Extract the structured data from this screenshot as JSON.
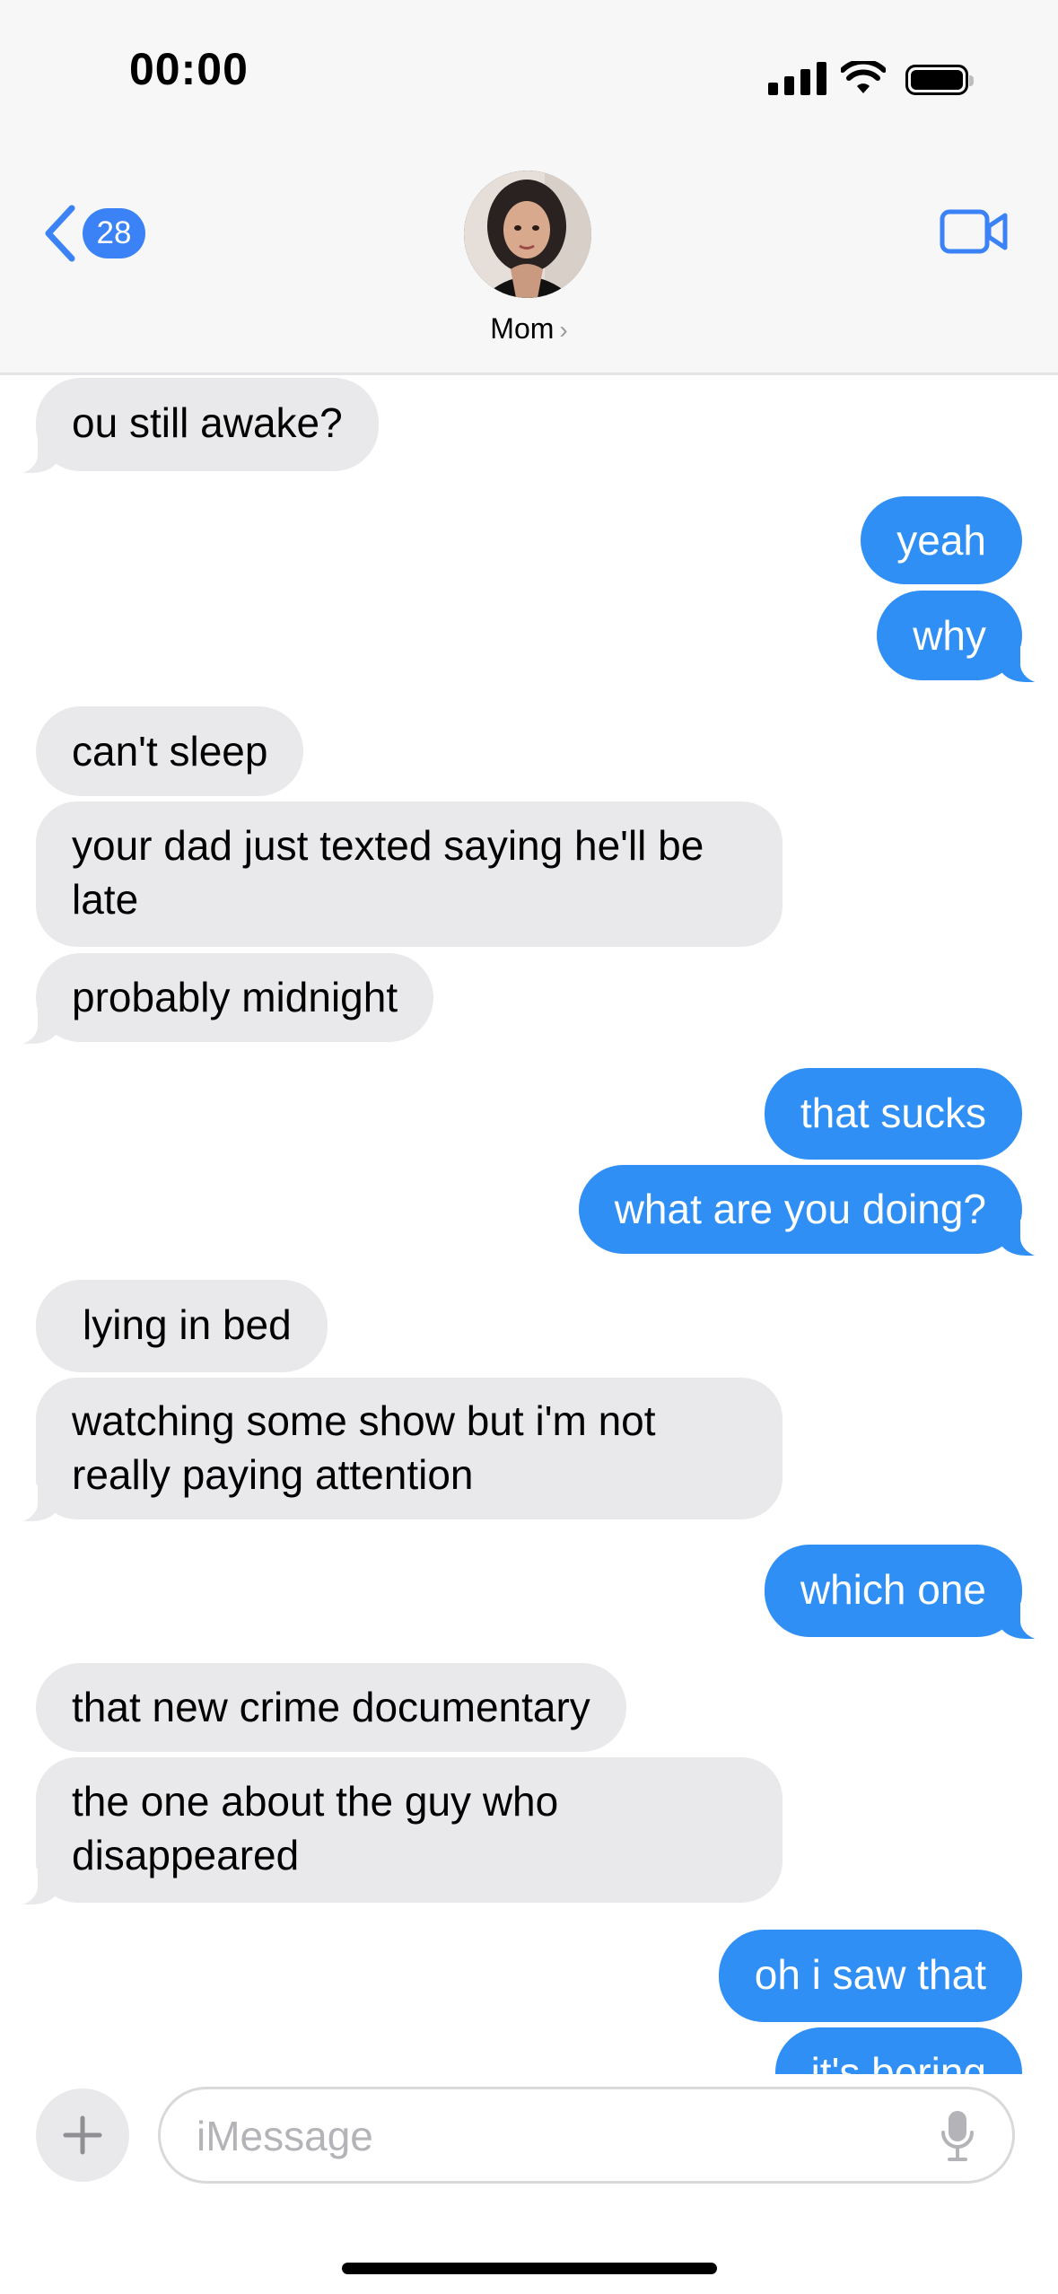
{
  "status_bar": {
    "time": "00:00"
  },
  "header": {
    "back_badge": "28",
    "contact_name": "Mom",
    "contact_chevron": "›"
  },
  "messages": [
    {
      "from": "them",
      "text": "ou still awake?"
    },
    {
      "from": "me",
      "text": "yeah"
    },
    {
      "from": "me",
      "text": "why"
    },
    {
      "from": "them",
      "text": "can't sleep"
    },
    {
      "from": "them",
      "text": "your dad just texted saying he'll be late"
    },
    {
      "from": "them",
      "text": "probably midnight"
    },
    {
      "from": "me",
      "text": "that sucks"
    },
    {
      "from": "me",
      "text": "what are you doing?"
    },
    {
      "from": "them",
      "text": "lying in bed"
    },
    {
      "from": "them",
      "text": "watching some show but i'm not really paying attention"
    },
    {
      "from": "me",
      "text": "which one"
    },
    {
      "from": "them",
      "text": "that new crime documentary"
    },
    {
      "from": "them",
      "text": "the one about the guy who disappeared"
    },
    {
      "from": "me",
      "text": "oh i saw that"
    },
    {
      "from": "me",
      "text": "it's boring"
    }
  ],
  "compose": {
    "placeholder": "iMessage"
  },
  "icons": {
    "back": "chevron-left-icon",
    "video": "video-camera-icon",
    "plus": "plus-icon",
    "mic": "microphone-icon",
    "signal": "signal-bars-icon",
    "wifi": "wifi-icon",
    "battery": "battery-icon"
  },
  "colors": {
    "accent": "#3b82f6",
    "outgoing_bubble": "#2f8ff5",
    "incoming_bubble": "#e9e9eb"
  }
}
